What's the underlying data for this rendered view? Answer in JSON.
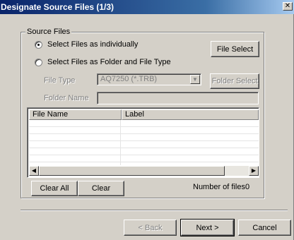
{
  "window": {
    "title": "Designate Source Files (1/3)",
    "close_glyph": "✕"
  },
  "source_files": {
    "group_label": "Source Files",
    "radio_individual": "Select Files as individually",
    "radio_folder": "Select Files as Folder and File Type",
    "file_select_button": "File Select",
    "file_type_label": "File Type",
    "file_type_value": "AQ7250 (*.TRB)",
    "folder_select_button": "Folder Select",
    "folder_name_label": "Folder Name",
    "folder_name_value": "",
    "table": {
      "columns": [
        "File Name",
        "Label"
      ],
      "rows": []
    },
    "clear_all_button": "Clear All",
    "clear_button": "Clear",
    "number_of_files": "Number of files0"
  },
  "footer": {
    "back_button": "< Back",
    "next_button": "Next >",
    "cancel_button": "Cancel"
  }
}
